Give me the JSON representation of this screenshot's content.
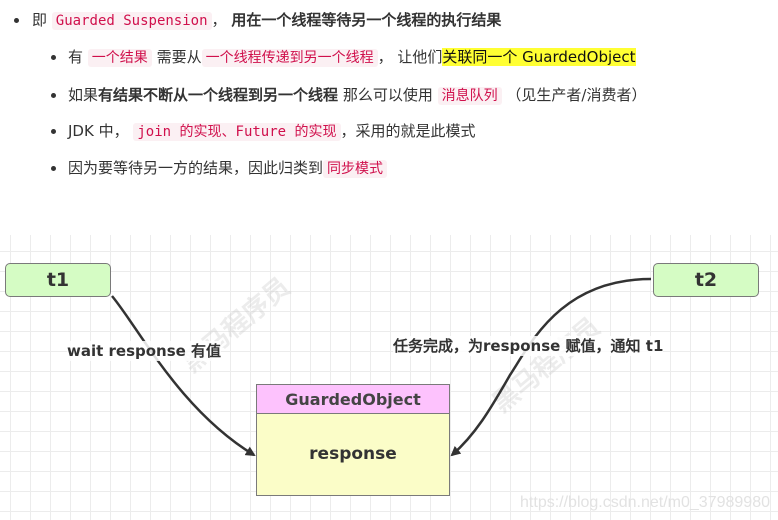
{
  "bullets": {
    "main": {
      "prefix": "即",
      "code": "Guarded Suspension",
      "sep": "，",
      "bold": "用在一个线程等待另一个线程的执行结果"
    },
    "sub": [
      {
        "t1": "有",
        "code1": "一个结果",
        "t2": "需要从",
        "code2": "一个线程传递到另一个线程",
        "t3": "， 让他们",
        "highlight": "关联同一个 GuardedObject"
      },
      {
        "t1": "如果",
        "bold": "有结果不断从一个线程到另一个线程",
        "t2": "那么可以使用",
        "code": "消息队列",
        "t3": "（见生产者/消费者）"
      },
      {
        "t1": "JDK 中，",
        "code": "join 的实现、Future 的实现",
        "t2": "，采用的就是此模式"
      },
      {
        "t1": "因为要等待另一方的结果，因此归类到",
        "code": "同步模式"
      }
    ]
  },
  "diagram": {
    "t1_label": "t1",
    "t2_label": "t2",
    "left_edge_label": "wait response 有值",
    "right_edge_label": "任务完成，为response 赋值，通知 t1",
    "object_title": "GuardedObject",
    "object_field": "response",
    "colors": {
      "thread_fill": "#d5fcc4",
      "object_header": "#fdc2fd",
      "object_body": "#fbfdc8",
      "code_text": "#d0104c",
      "highlight": "#ffff33"
    }
  },
  "watermark": "https://blog.csdn.net/m0_37989980",
  "stamp": "黑马程序员"
}
